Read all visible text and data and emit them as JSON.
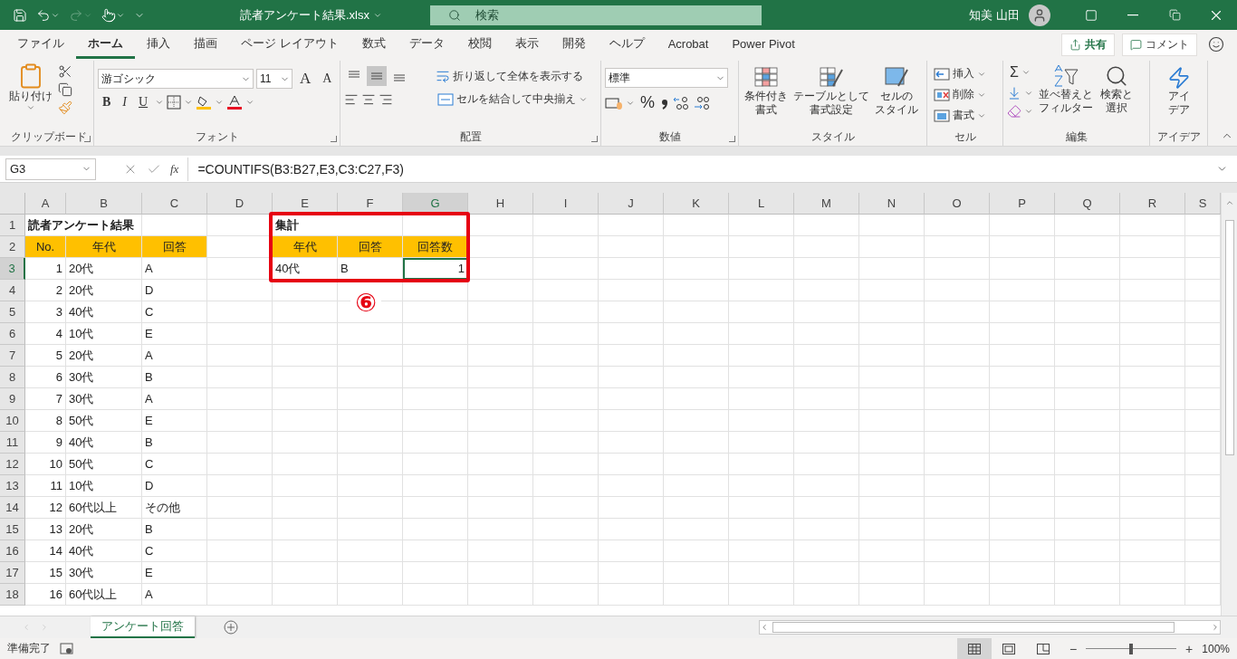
{
  "title_bar": {
    "file_name": "読者アンケート結果.xlsx",
    "search_placeholder": "検索",
    "user_name": "知美 山田"
  },
  "menu_tabs": [
    {
      "label": "ファイル",
      "selected": false
    },
    {
      "label": "ホーム",
      "selected": true
    },
    {
      "label": "挿入",
      "selected": false
    },
    {
      "label": "描画",
      "selected": false
    },
    {
      "label": "ページ レイアウト",
      "selected": false
    },
    {
      "label": "数式",
      "selected": false
    },
    {
      "label": "データ",
      "selected": false
    },
    {
      "label": "校閲",
      "selected": false
    },
    {
      "label": "表示",
      "selected": false
    },
    {
      "label": "開発",
      "selected": false
    },
    {
      "label": "ヘルプ",
      "selected": false
    },
    {
      "label": "Acrobat",
      "selected": false
    },
    {
      "label": "Power Pivot",
      "selected": false
    }
  ],
  "share_button": "共有",
  "comment_button": "コメント",
  "ribbon": {
    "clipboard": {
      "paste": "貼り付け",
      "label": "クリップボード"
    },
    "font": {
      "name": "游ゴシック",
      "size": "11",
      "grow": "A",
      "shrink": "A",
      "bold": "B",
      "italic": "I",
      "underline": "U",
      "label": "フォント"
    },
    "alignment": {
      "vertical": [
        {
          "selected": false
        },
        {
          "selected": true
        },
        {
          "selected": false
        }
      ],
      "wrap": "折り返して全体を表示する",
      "merge": "セルを結合して中央揃え",
      "label": "配置"
    },
    "number": {
      "format": "標準",
      "percent": "%",
      "label": "数値"
    },
    "styles": {
      "buttons": [
        {
          "kind": "conditional",
          "lines": [
            "条件付き",
            "書式"
          ]
        },
        {
          "kind": "table",
          "lines": [
            "テーブルとして",
            "書式設定"
          ]
        },
        {
          "kind": "cellstyle",
          "lines": [
            "セルの",
            "スタイル"
          ]
        }
      ],
      "label": "スタイル"
    },
    "cells": {
      "buttons": [
        {
          "kind": "insert",
          "text": "挿入"
        },
        {
          "kind": "delete",
          "text": "削除"
        },
        {
          "kind": "format",
          "text": "書式"
        }
      ],
      "label": "セル"
    },
    "editing": {
      "sum": "Σ",
      "sort": [
        "並べ替えと",
        "フィルター"
      ],
      "find": [
        "検索と",
        "選択"
      ],
      "label": "編集"
    },
    "ideas": {
      "button": [
        "アイ",
        "デア"
      ],
      "label": "アイデア"
    }
  },
  "formula_bar": {
    "name_box": "G3",
    "fx": "fx",
    "formula": "=COUNTIFS(B3:B27,E3,C3:C27,F3)"
  },
  "columns": [
    {
      "label": "A",
      "selected": false,
      "numeric": true
    },
    {
      "label": "B",
      "selected": false,
      "numeric": false
    },
    {
      "label": "C",
      "selected": false,
      "numeric": false
    },
    {
      "label": "D",
      "selected": false,
      "numeric": false
    },
    {
      "label": "E",
      "selected": false,
      "numeric": false
    },
    {
      "label": "F",
      "selected": false,
      "numeric": false
    },
    {
      "label": "G",
      "selected": true,
      "numeric": true
    },
    {
      "label": "H",
      "selected": false,
      "numeric": false
    },
    {
      "label": "I",
      "selected": false,
      "numeric": false
    },
    {
      "label": "J",
      "selected": false,
      "numeric": false
    },
    {
      "label": "K",
      "selected": false,
      "numeric": false
    },
    {
      "label": "L",
      "selected": false,
      "numeric": false
    },
    {
      "label": "M",
      "selected": false,
      "numeric": false
    },
    {
      "label": "N",
      "selected": false,
      "numeric": false
    },
    {
      "label": "O",
      "selected": false,
      "numeric": false
    },
    {
      "label": "P",
      "selected": false,
      "numeric": false
    },
    {
      "label": "Q",
      "selected": false,
      "numeric": false
    },
    {
      "label": "R",
      "selected": false,
      "numeric": false
    },
    {
      "label": "S",
      "selected": false,
      "numeric": false
    }
  ],
  "rows": [
    {
      "number": "1",
      "selected": false,
      "kind": "title",
      "cells": {
        "A": "読者アンケート結果",
        "E": "集計"
      }
    },
    {
      "number": "2",
      "selected": false,
      "kind": "header",
      "cells": {
        "A": "No.",
        "B": "年代",
        "C": "回答",
        "E": "年代",
        "F": "回答",
        "G": "回答数"
      }
    },
    {
      "number": "3",
      "selected": true,
      "kind": "data",
      "cells": {
        "A": "1",
        "B": "20代",
        "C": "A",
        "E": "40代",
        "F": "B",
        "G": "1"
      }
    },
    {
      "number": "4",
      "selected": false,
      "kind": "data",
      "cells": {
        "A": "2",
        "B": "20代",
        "C": "D"
      }
    },
    {
      "number": "5",
      "selected": false,
      "kind": "data",
      "cells": {
        "A": "3",
        "B": "40代",
        "C": "C"
      }
    },
    {
      "number": "6",
      "selected": false,
      "kind": "data",
      "cells": {
        "A": "4",
        "B": "10代",
        "C": "E"
      }
    },
    {
      "number": "7",
      "selected": false,
      "kind": "data",
      "cells": {
        "A": "5",
        "B": "20代",
        "C": "A"
      }
    },
    {
      "number": "8",
      "selected": false,
      "kind": "data",
      "cells": {
        "A": "6",
        "B": "30代",
        "C": "B"
      }
    },
    {
      "number": "9",
      "selected": false,
      "kind": "data",
      "cells": {
        "A": "7",
        "B": "30代",
        "C": "A"
      }
    },
    {
      "number": "10",
      "selected": false,
      "kind": "data",
      "cells": {
        "A": "8",
        "B": "50代",
        "C": "E"
      }
    },
    {
      "number": "11",
      "selected": false,
      "kind": "data",
      "cells": {
        "A": "9",
        "B": "40代",
        "C": "B"
      }
    },
    {
      "number": "12",
      "selected": false,
      "kind": "data",
      "cells": {
        "A": "10",
        "B": "50代",
        "C": "C"
      }
    },
    {
      "number": "13",
      "selected": false,
      "kind": "data",
      "cells": {
        "A": "11",
        "B": "10代",
        "C": "D"
      }
    },
    {
      "number": "14",
      "selected": false,
      "kind": "data",
      "cells": {
        "A": "12",
        "B": "60代以上",
        "C": "その他"
      }
    },
    {
      "number": "15",
      "selected": false,
      "kind": "data",
      "cells": {
        "A": "13",
        "B": "20代",
        "C": "B"
      }
    },
    {
      "number": "16",
      "selected": false,
      "kind": "data",
      "cells": {
        "A": "14",
        "B": "40代",
        "C": "C"
      }
    },
    {
      "number": "17",
      "selected": false,
      "kind": "data",
      "cells": {
        "A": "15",
        "B": "30代",
        "C": "E"
      }
    },
    {
      "number": "18",
      "selected": false,
      "kind": "data",
      "cells": {
        "A": "16",
        "B": "60代以上",
        "C": "A"
      }
    }
  ],
  "annotation": {
    "callout": "⑥"
  },
  "sheet_tabs": [
    {
      "label": "アンケート回答",
      "selected": true
    }
  ],
  "status_bar": {
    "status": "準備完了",
    "zoom_minus": "−",
    "zoom_plus": "+",
    "zoom_slider": {
      "level": 0.5
    },
    "zoom": "100%"
  }
}
